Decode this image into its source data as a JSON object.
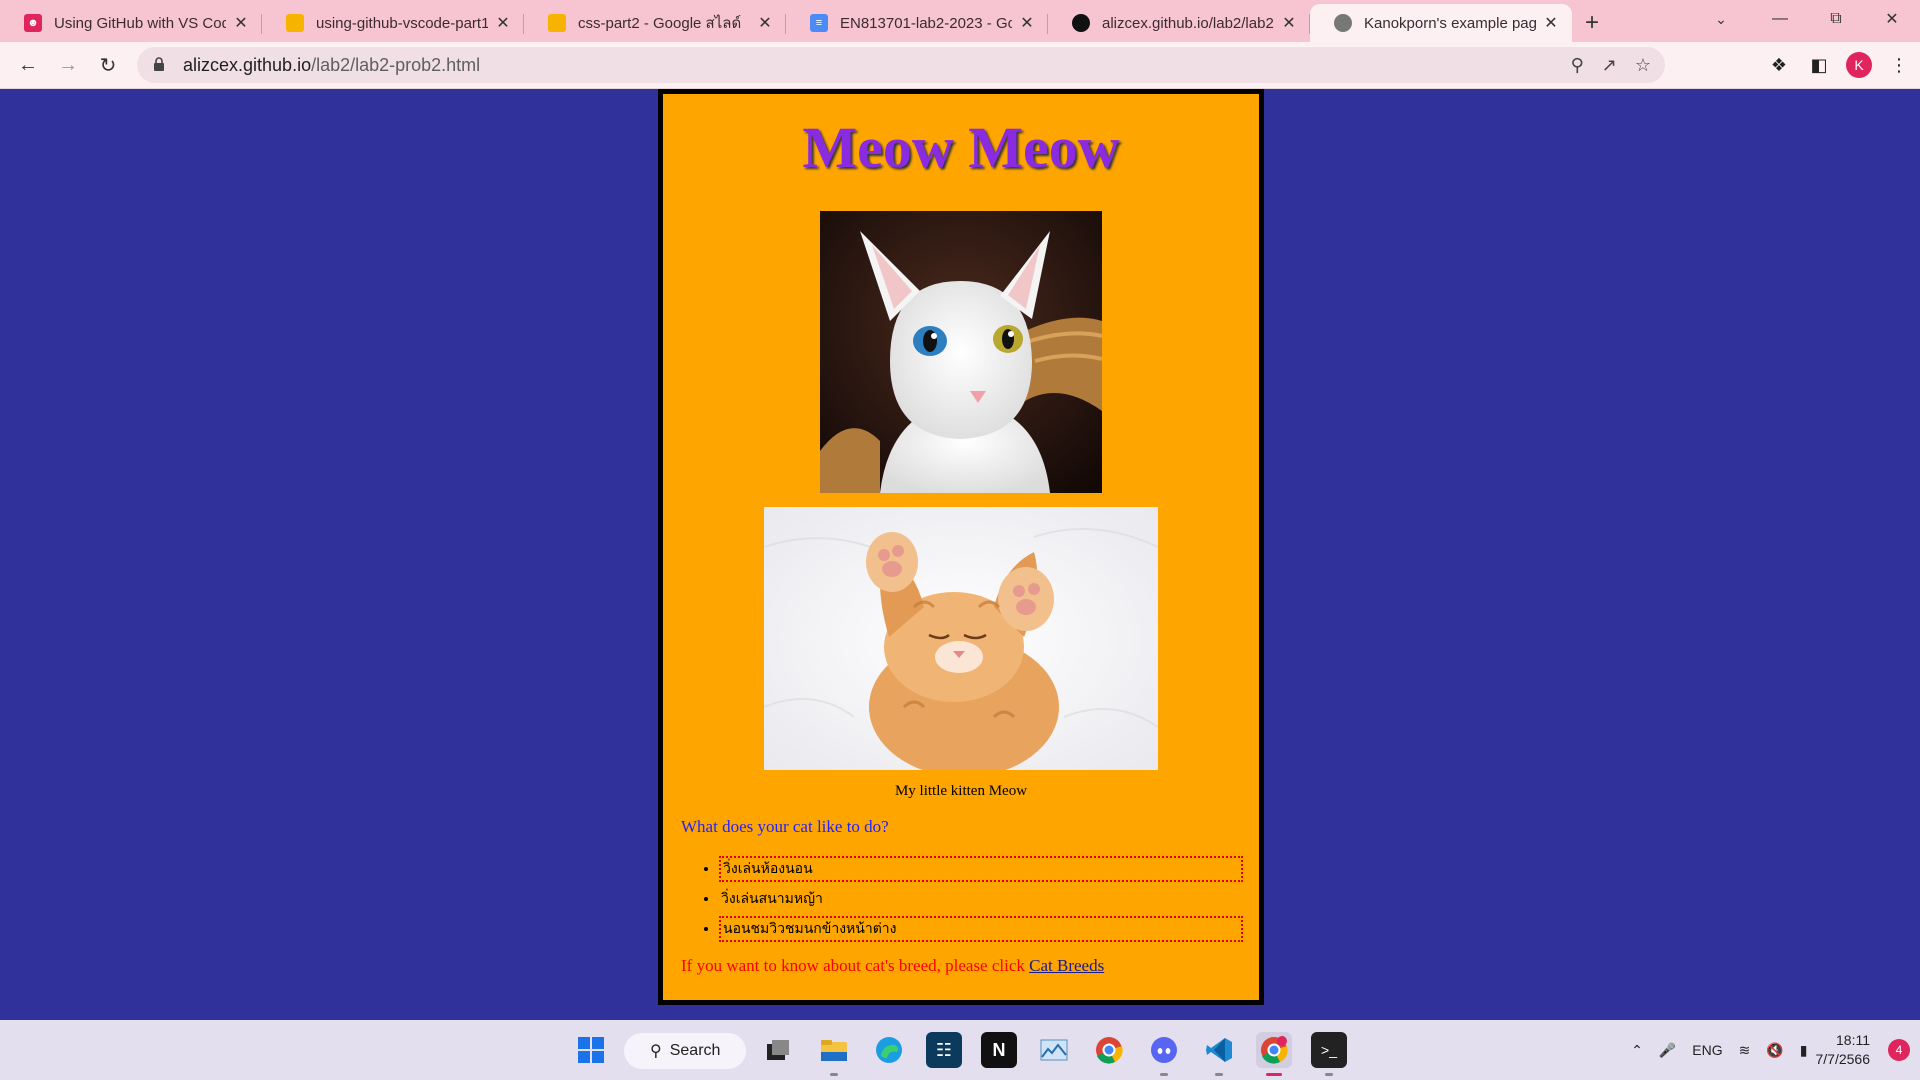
{
  "browser": {
    "tabs": [
      {
        "title": "Using GitHub with VS Code",
        "icon": "person-icon"
      },
      {
        "title": "using-github-vscode-part1",
        "icon": "slides-icon"
      },
      {
        "title": "css-part2 - Google สไลด์",
        "icon": "slides-icon"
      },
      {
        "title": "EN813701-lab2-2023 - Goo",
        "icon": "docs-icon"
      },
      {
        "title": "alizcex.github.io/lab2/lab2-",
        "icon": "github-icon"
      },
      {
        "title": "Kanokporn's example page",
        "icon": "globe-icon",
        "active": true
      }
    ],
    "url_host": "alizcex.github.io",
    "url_path": "/lab2/lab2-prob2.html",
    "profile_initial": "K"
  },
  "page": {
    "title": "Meow Meow",
    "caption": "My little kitten Meow",
    "question": "What does your cat like to do?",
    "activities": [
      "วิ่งเล่นห้องนอน",
      "วิ่งเล่นสนามหญ้า",
      "นอนชมวิวชมนกข้างหน้าต่าง"
    ],
    "breed_note": "If you want to know about cat's breed, please click ",
    "breed_link": "Cat Breeds",
    "colors": {
      "background": "#30319b",
      "card": "#ffa500",
      "title": "#8a2be2",
      "question": "#2222ff",
      "note": "#ff0000"
    }
  },
  "taskbar": {
    "search_label": "Search",
    "language": "ENG",
    "time": "18:11",
    "date": "7/7/2566",
    "notification_count": "4"
  }
}
